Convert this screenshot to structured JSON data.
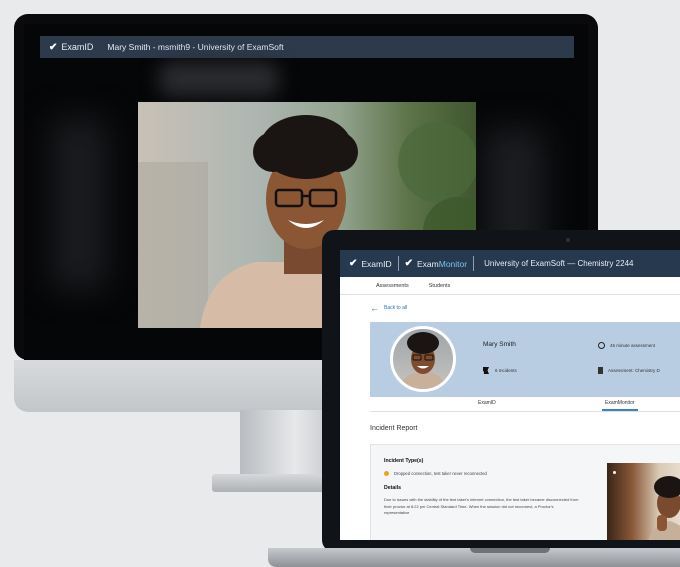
{
  "desktop": {
    "brand": "ExamID",
    "title": "Mary Smith - msmith9 - University of ExamSoft"
  },
  "laptop": {
    "brand_id": "ExamID",
    "brand_monitor_prefix": "Exam",
    "brand_monitor_suffix": "Monitor",
    "header_title": "University of ExamSoft  —  Chemistry 2244",
    "tabs": [
      "Assessments",
      "Students"
    ],
    "back_label": "Back to all",
    "student": {
      "name": "Mary Smith",
      "incidents": "6 Incidents",
      "duration": "45 minute assessment",
      "assessment": "Assessment: Chemistry D"
    },
    "subtabs": [
      "ExamID",
      "ExamMonitor"
    ],
    "active_subtab": "ExamMonitor",
    "report_title": "Incident Report",
    "incident_card": {
      "type_heading": "Incident Type(s)",
      "type_value": "Dropped connection, test taker never reconnected",
      "details_heading": "Details",
      "details_text": "Due to issues with the stability of the test taker's internet connection, the test taker became disconnected from their proctor at 8:22 pm Central Standard Time. When the session did not reconnect, a Proctor's representative"
    }
  },
  "colors": {
    "header_bg": "#27394f",
    "profile_bg": "#b9cde2",
    "accent": "#3b82c4",
    "warning_dot": "#f0a21b"
  },
  "icons": [
    "check-icon",
    "back-arrow-icon",
    "flag-icon",
    "clock-icon",
    "document-icon"
  ]
}
